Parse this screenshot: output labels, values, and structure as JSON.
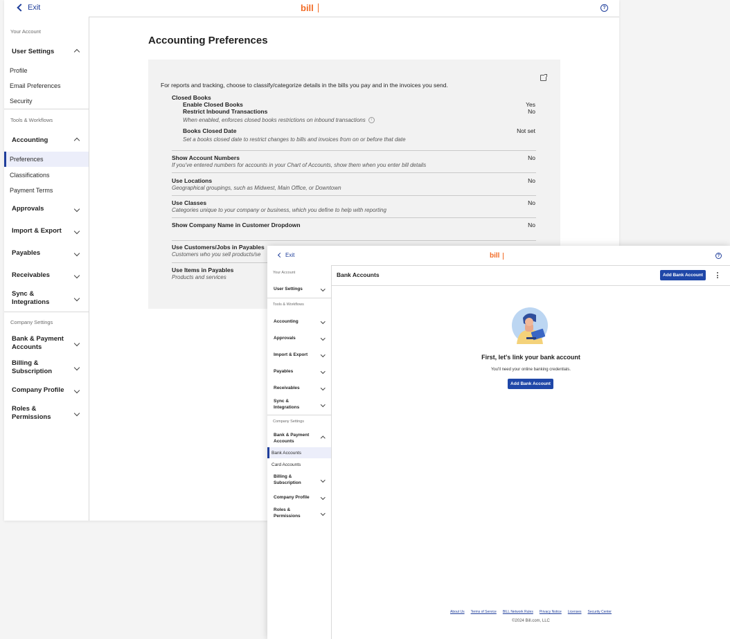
{
  "colors": {
    "brand_orange": "#f26a24",
    "primary_blue": "#1f47a8",
    "link_blue": "#1f3e9b"
  },
  "prefs_window": {
    "exit_label": "Exit",
    "logo": "bill",
    "help_icon": "?",
    "sidebar": {
      "your_account_caption": "Your Account",
      "user_settings": "User Settings",
      "profile": "Profile",
      "email_preferences": "Email Preferences",
      "security": "Security",
      "tools_caption": "Tools & Workflows",
      "accounting": "Accounting",
      "preferences": "Preferences",
      "classifications": "Classifications",
      "payment_terms": "Payment Terms",
      "approvals": "Approvals",
      "import_export": "Import & Export",
      "payables": "Payables",
      "receivables": "Receivables",
      "sync_line1": "Sync &",
      "sync_line2": "Integrations",
      "company_caption": "Company Settings",
      "bank_line1": "Bank & Payment",
      "bank_line2": "Accounts",
      "billing_line1": "Billing &",
      "billing_line2": "Subscription",
      "company_profile": "Company Profile",
      "roles_line1": "Roles &",
      "roles_line2": "Permissions"
    },
    "title": "Accounting Preferences",
    "intro": "For reports and tracking, choose to classify/categorize details in the bills you pay and in the invoices you send.",
    "closed_books": {
      "heading": "Closed Books",
      "enable_label": "Enable Closed Books",
      "enable_value": "Yes",
      "restrict_label": "Restrict Inbound Transactions",
      "restrict_value": "No",
      "restrict_desc": "When enabled, enforces closed books restrictions on inbound transactions",
      "date_label": "Books Closed Date",
      "date_value": "Not set",
      "date_desc": "Set a books closed date to restrict changes to bills and invoices from on or before that date"
    },
    "account_numbers": {
      "label": "Show Account Numbers",
      "desc": "If you've entered numbers for accounts in your Chart of Accounts, show them when you enter bill details",
      "value": "No"
    },
    "locations": {
      "label": "Use Locations",
      "desc": "Geographical groupings, such as Midwest, Main Office, or Downtown",
      "value": "No"
    },
    "classes": {
      "label": "Use Classes",
      "desc": "Categories unique to your company or business, which you define to help with reporting",
      "value": "No"
    },
    "company_name": {
      "label": "Show Company Name in Customer Dropdown",
      "value": "No"
    },
    "customers_jobs": {
      "label": "Use Customers/Jobs in Payables",
      "desc": "Customers who you sell products/se"
    },
    "items": {
      "label": "Use Items in Payables",
      "desc": "Products and services"
    }
  },
  "bank_window": {
    "exit_label": "Exit",
    "logo": "bill",
    "help_icon": "?",
    "sidebar": {
      "your_account_caption": "Your Account",
      "user_settings": "User Settings",
      "tools_caption": "Tools & Workflows",
      "accounting": "Accounting",
      "approvals": "Approvals",
      "import_export": "Import & Export",
      "payables": "Payables",
      "receivables": "Receivables",
      "sync_line1": "Sync &",
      "sync_line2": "Integrations",
      "company_caption": "Company Settings",
      "bank_line1": "Bank & Payment",
      "bank_line2": "Accounts",
      "bank_accounts": "Bank Accounts",
      "card_accounts": "Card Accounts",
      "billing_line1": "Billing &",
      "billing_line2": "Subscription",
      "company_profile": "Company Profile",
      "roles_line1": "Roles &",
      "roles_line2": "Permissions"
    },
    "title": "Bank Accounts",
    "add_button": "Add Bank Account",
    "empty_title": "First, let's link your bank account",
    "empty_sub": "You'll need your online banking credentials.",
    "footer_links": [
      "About Us",
      "Terms of Service",
      "BILL Network Rules",
      "Privacy Notice",
      "Licenses",
      "Security Center"
    ],
    "copyright": "©2024 Bill.com, LLC"
  }
}
